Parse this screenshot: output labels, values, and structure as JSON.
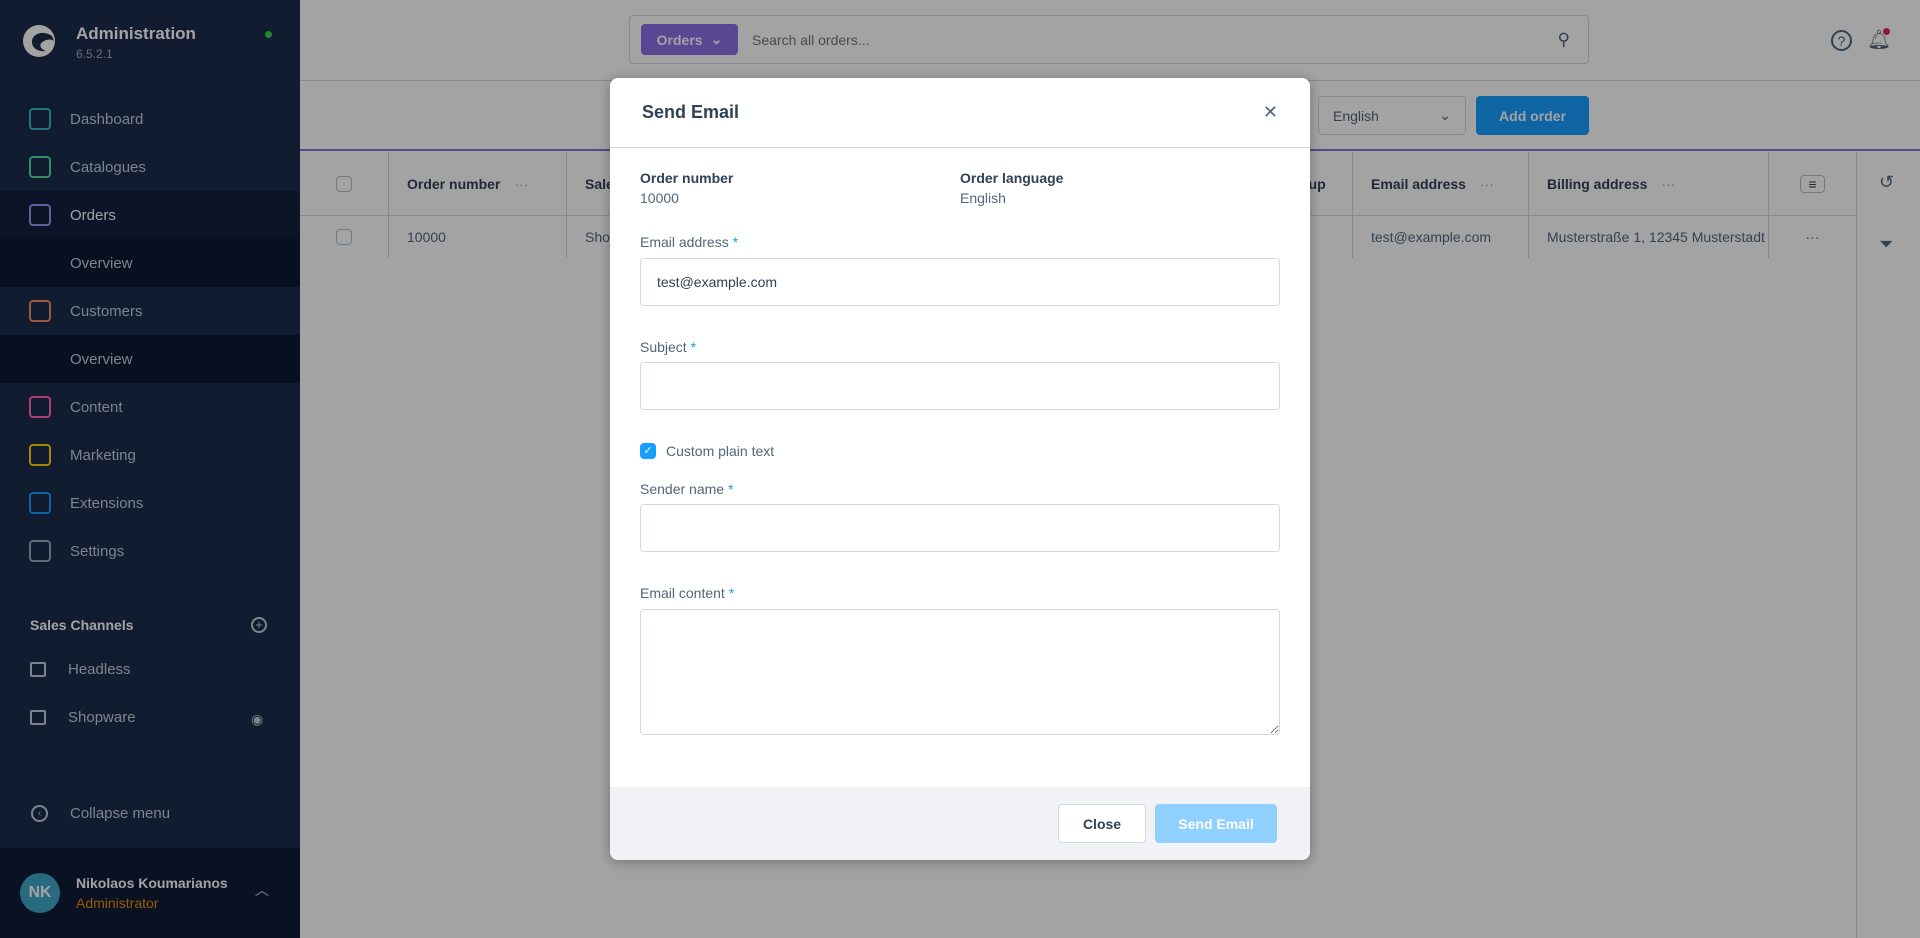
{
  "app": {
    "title": "Administration",
    "version": "6.5.2.1",
    "status_color": "#37d046"
  },
  "sidebar": {
    "items": [
      {
        "label": "Dashboard",
        "icon": "dashboard-icon",
        "color": "#3fb3c7"
      },
      {
        "label": "Catalogues",
        "icon": "catalogue-icon",
        "color": "#57d9a3"
      },
      {
        "label": "Orders",
        "icon": "orders-icon",
        "color": "#a092f0",
        "active": true
      },
      {
        "label": "Overview",
        "sub": true
      },
      {
        "label": "Customers",
        "icon": "customers-icon",
        "color": "#f88962"
      },
      {
        "label": "Overview",
        "sub": true
      },
      {
        "label": "Content",
        "icon": "content-icon",
        "color": "#ff68b4"
      },
      {
        "label": "Marketing",
        "icon": "marketing-icon",
        "color": "#ffd700"
      },
      {
        "label": "Extensions",
        "icon": "extensions-icon",
        "color": "#189eff"
      },
      {
        "label": "Settings",
        "icon": "settings-icon",
        "color": "#9aa8b5"
      }
    ],
    "sales_channels_title": "Sales Channels",
    "channels": [
      {
        "label": "Headless",
        "icon": "basket-icon"
      },
      {
        "label": "Shopware",
        "icon": "storefront-icon"
      }
    ],
    "collapse": "Collapse menu",
    "user": {
      "initials": "NK",
      "name": "Nikolaos Koumarianos",
      "role": "Administrator"
    }
  },
  "header": {
    "search_type": "Orders",
    "search_placeholder": "Search all orders..."
  },
  "toolbar": {
    "language": "English",
    "add_order": "Add order"
  },
  "table": {
    "columns": [
      "Order number",
      "Sale",
      "oup",
      "Email address",
      "Billing address"
    ],
    "rows": [
      {
        "order_number": "10000",
        "sales_channel": "Sho",
        "email": "test@example.com",
        "billing": "Musterstraße 1, 12345 Musterstadt"
      }
    ]
  },
  "modal": {
    "title": "Send Email",
    "order_number_label": "Order number",
    "order_number": "10000",
    "order_language_label": "Order language",
    "order_language": "English",
    "email_label": "Email address",
    "email_value": "test@example.com",
    "subject_label": "Subject",
    "subject_value": "",
    "custom_plain_text": "Custom plain text",
    "custom_plain_text_checked": true,
    "sender_label": "Sender name",
    "sender_value": "",
    "content_label": "Email content",
    "content_value": "",
    "required": "*",
    "close": "Close",
    "send": "Send Email"
  }
}
